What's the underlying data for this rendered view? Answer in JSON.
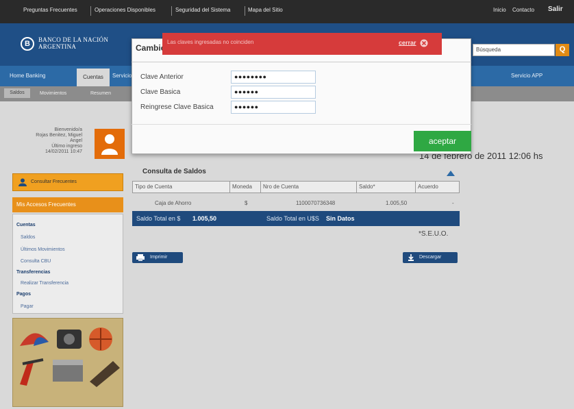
{
  "topbar": {
    "links": [
      "Preguntas Frecuentes",
      "Operaciones Disponibles",
      "Seguridad del Sistema",
      "Mapa del Sitio"
    ],
    "right": [
      "Inicio",
      "Contacto",
      "Salir"
    ]
  },
  "header": {
    "logo_text": "BANCO DE LA NACIÓN ARGENTINA",
    "search_value": "Búsqueda"
  },
  "nav": {
    "items": [
      "Home Banking",
      "Cuentas",
      "Servicios",
      "Servicio APP"
    ],
    "active": "Cuentas"
  },
  "subnav": {
    "items": [
      "Saldos",
      "Movimientos",
      "Resumen"
    ]
  },
  "sidebar": {
    "welcome": [
      "Bienvenido/a",
      "Rojas Benitez, Miguel",
      "Angel",
      "Último ingreso",
      "14/02/2011 10:47"
    ],
    "datos_button": "Consultar Frecuentes",
    "accesos_header": "Mis Accesos Frecuentes",
    "accesos": [
      {
        "label": "Cuentas",
        "cat": true
      },
      {
        "label": "Saldos",
        "cat": false
      },
      {
        "label": "Últimos Movimientos",
        "cat": false
      },
      {
        "label": "Consulta CBU",
        "cat": false
      },
      {
        "label": "Transferencias",
        "cat": true
      },
      {
        "label": "Realizar Transferencia",
        "cat": false
      },
      {
        "label": "Pagos",
        "cat": true
      },
      {
        "label": "Pagar",
        "cat": false
      }
    ]
  },
  "main": {
    "date": "14 de febrero de 2011  12:06 hs",
    "panel_title": "Consulta de Saldos",
    "table": {
      "headers": [
        "Tipo de Cuenta",
        "Moneda",
        "Nro de Cuenta",
        "Saldo*",
        "Acuerdo"
      ],
      "row": [
        "Caja de Ahorro",
        "$",
        "1100070736348",
        "1.005,50",
        "-"
      ]
    },
    "totals": {
      "pesos_label": "Saldo Total en $",
      "pesos_value": "1.005,50",
      "usd_label": "Saldo Total en U$S",
      "usd_value": "Sin Datos"
    },
    "footnote": "*S.E.U.O.",
    "print_button": "Imprimir",
    "download_button": "Descargar"
  },
  "modal": {
    "title": "Cambio de Clave",
    "error_message": "Las claves ingresadas no coinciden",
    "close_label": "cerrar",
    "fields": [
      {
        "label": "Clave Anterior",
        "value": "●●●●●●●●"
      },
      {
        "label": "Clave Basica",
        "value": "●●●●●●"
      },
      {
        "label": "Reingrese Clave Basica",
        "value": "●●●●●●"
      }
    ],
    "accept_label": "aceptar"
  },
  "colors": {
    "primary_blue": "#1f4f86",
    "nav_blue": "#2c6aa6",
    "accent_orange": "#e8901a",
    "error_red": "#d63b3b",
    "success_green": "#2fa843"
  }
}
